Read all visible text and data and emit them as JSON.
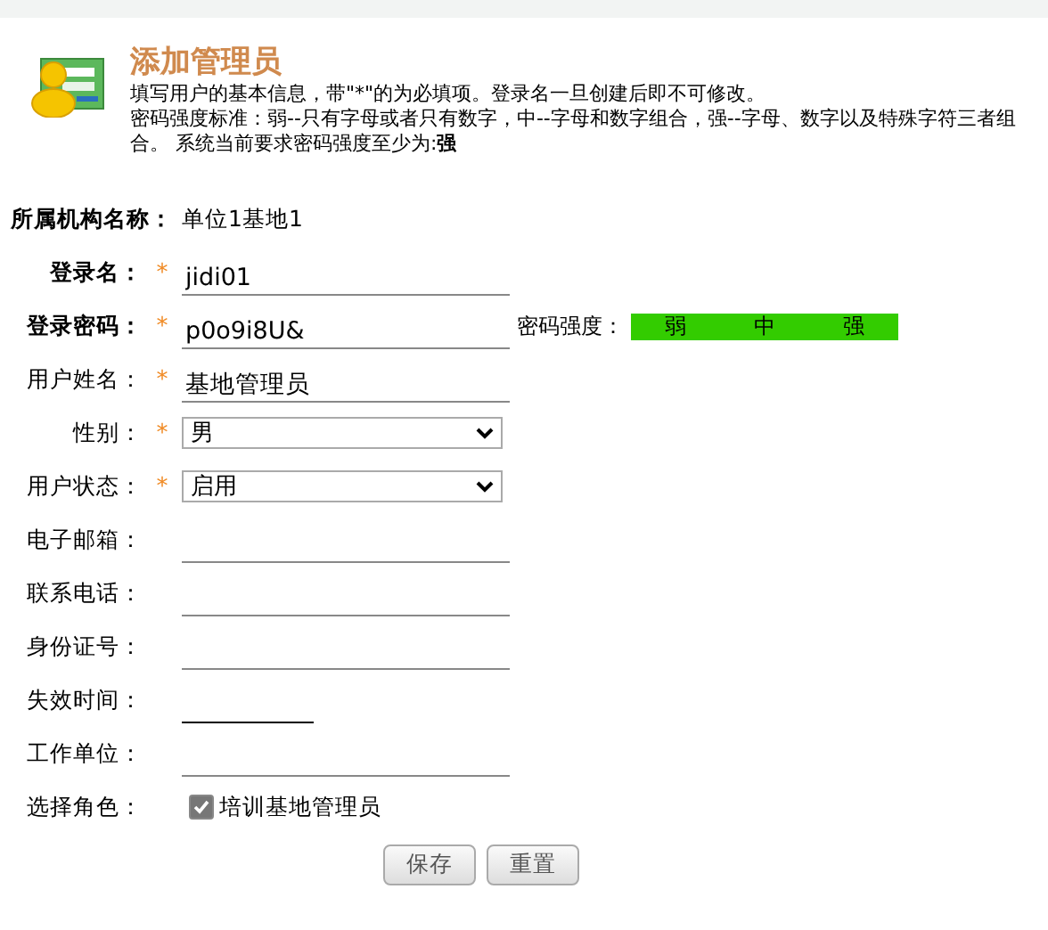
{
  "header": {
    "title": "添加管理员",
    "lines": [
      "填写用户的基本信息，带\"*\"的为必填项。登录名一旦创建后即不可修改。",
      "密码强度标准：弱--只有字母或者只有数字，中--字母和数字组合，强--字母、数字以及特殊字符三者组合。 系统当前要求密码强度至少为:**强**"
    ]
  },
  "fields": [
    {
      "kind": "static",
      "label": "所属机构名称：",
      "bold": true,
      "required": false,
      "value": "单位1基地1"
    },
    {
      "kind": "text",
      "label": "登录名：",
      "bold": true,
      "required": true,
      "value": "jidi01"
    },
    {
      "kind": "password",
      "label": "登录密码：",
      "bold": true,
      "required": true,
      "value": "p0o9i8U&",
      "strength_label": "密码强度：",
      "strength": [
        {
          "label": "弱",
          "lit": true
        },
        {
          "label": "中",
          "lit": true
        },
        {
          "label": "强",
          "lit": true
        }
      ]
    },
    {
      "kind": "text",
      "label": "用户姓名：",
      "bold": false,
      "required": true,
      "value": "基地管理员"
    },
    {
      "kind": "select",
      "label": "性别：",
      "bold": false,
      "required": true,
      "value": "男"
    },
    {
      "kind": "select",
      "label": "用户状态：",
      "bold": false,
      "required": true,
      "value": "启用"
    },
    {
      "kind": "text",
      "label": "电子邮箱：",
      "bold": false,
      "required": false
    },
    {
      "kind": "text",
      "label": "联系电话：",
      "bold": false,
      "required": false
    },
    {
      "kind": "text",
      "label": "身份证号：",
      "bold": false,
      "required": false
    },
    {
      "kind": "date",
      "label": "失效时间：",
      "bold": false,
      "required": false
    },
    {
      "kind": "text",
      "label": "工作单位：",
      "bold": false,
      "required": false
    },
    {
      "kind": "checkbox",
      "label": "选择角色：",
      "bold": false,
      "required": false,
      "option": "培训基地管理员",
      "checked": true
    }
  ],
  "required_mark": "*",
  "buttons": [
    "保存",
    "重置"
  ]
}
